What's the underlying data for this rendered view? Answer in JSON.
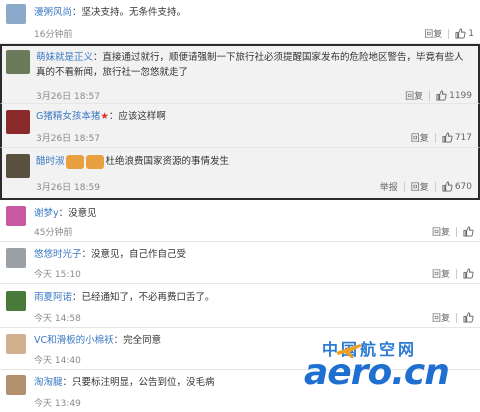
{
  "comments": [
    {
      "user": "漫粥风尚",
      "text": "：坚决支持。无条件支持。",
      "time": "16分钟前",
      "reply": "回复",
      "likes": "1",
      "avatar_color": "#8aa8c8"
    },
    {
      "user": "萌妹就是正义",
      "text": "：直接通过就行，顺便请强制一下旅行社必须提醒国家发布的危险地区警告，毕竟有些人真的不看新闻，旅行社一忽悠就走了",
      "time": "3月26日 18:57",
      "reply": "回复",
      "likes": "1199",
      "avatar_color": "#6b7a5a"
    },
    {
      "user": "G猪精女孩本猪",
      "text": "：应该这样啊",
      "time": "3月26日 18:57",
      "reply": "回复",
      "likes": "717",
      "avatar_color": "#8a2a2a"
    },
    {
      "user": "醋时淑",
      "text": "杜绝浪费国家资源的事情发生",
      "time": "3月26日 18:59",
      "report": "举报",
      "reply": "回复",
      "likes": "670",
      "avatar_color": "#5a5040"
    },
    {
      "user": "谢梦y",
      "text": "：没意见",
      "time": "45分钟前",
      "reply": "回复",
      "likes": "",
      "avatar_color": "#c85aa0"
    },
    {
      "user": "悠悠时光子",
      "text": "：没意见，自己作自己受",
      "time": "今天 15:10",
      "reply": "回复",
      "likes": "",
      "avatar_color": "#9aa0a6"
    },
    {
      "user": "雨夏阿诺",
      "text": "：已经通知了，不必再费口舌了。",
      "time": "今天 14:58",
      "reply": "回复",
      "likes": "",
      "avatar_color": "#4a7a3a"
    },
    {
      "user": "VC和滑板的小棉袄",
      "text": "：完全同意",
      "time": "今天 14:40",
      "reply": "回复",
      "likes": "",
      "avatar_color": "#d0b090"
    },
    {
      "user": "淘淘腱",
      "text": "：只要标注明显，公告到位，没毛病",
      "time": "今天 13:49",
      "reply": "回复",
      "likes": "",
      "avatar_color": "#b09070"
    }
  ],
  "watermark": {
    "cn": "中国航空网",
    "en": "aero.cn"
  },
  "colors": {
    "username": "#3a79c4",
    "highlight_bg": "#f2f2f2",
    "logo": "#1e6fd0"
  }
}
